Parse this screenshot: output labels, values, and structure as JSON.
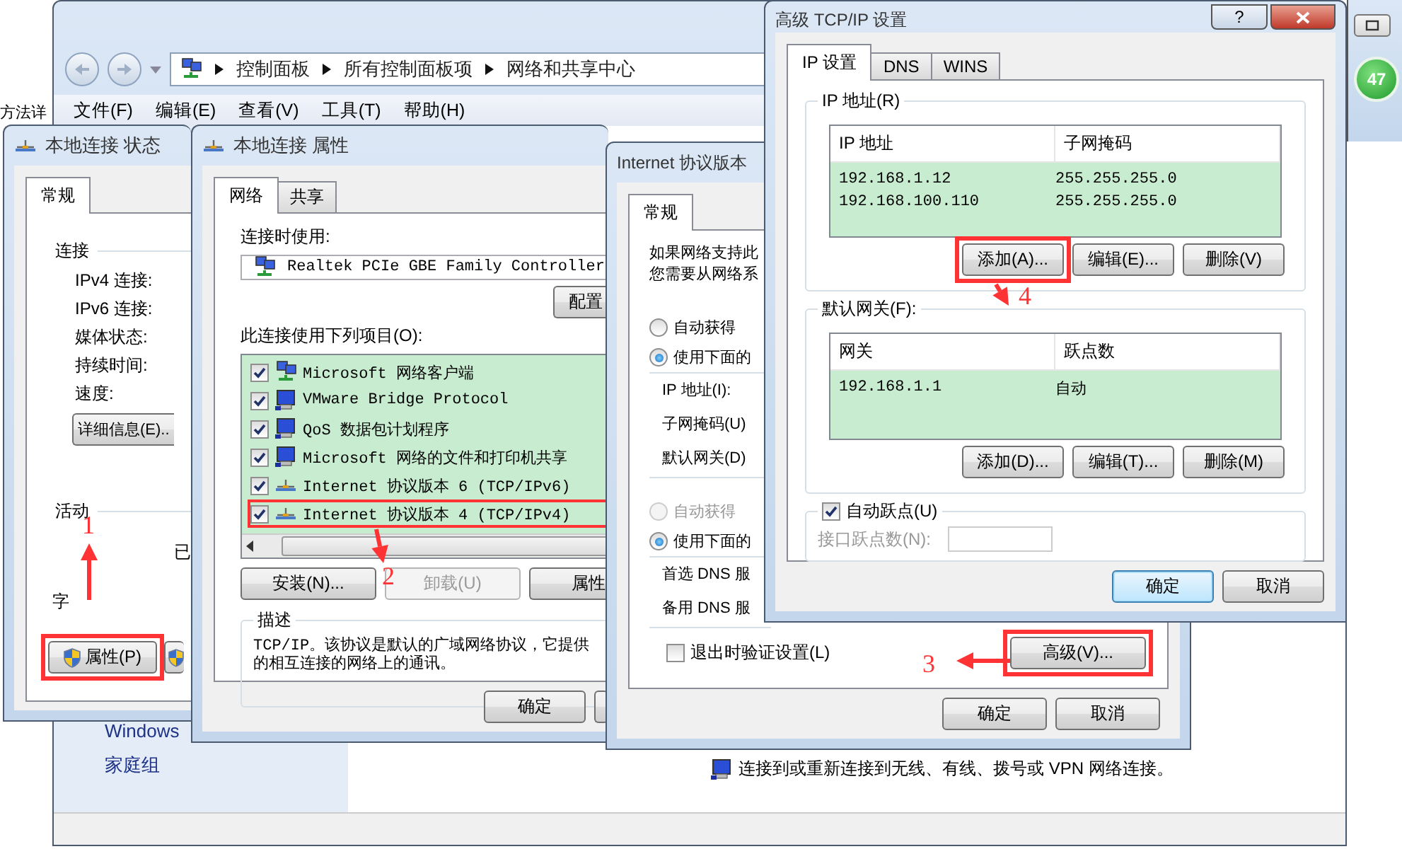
{
  "background_page": {
    "text": "方法详"
  },
  "explorer": {
    "breadcrumb": [
      "控制面板",
      "所有控制面板项",
      "网络和共享中心"
    ],
    "menu": [
      "文件(F)",
      "编辑(E)",
      "查看(V)",
      "工具(T)",
      "帮助(H)"
    ],
    "sidebar_links": [
      "Windows",
      "家庭组"
    ],
    "task_text": "连接到或重新连接到无线、有线、拨号或 VPN 网络连接。"
  },
  "side_window": {
    "badge": "47"
  },
  "status_dialog": {
    "title": "本地连接 状态",
    "tabs": [
      {
        "label": "常规",
        "selected": true
      }
    ],
    "connection_group": "连接",
    "fields": [
      "IPv4 连接:",
      "IPv6 连接:",
      "媒体状态:",
      "持续时间:",
      "速度:"
    ],
    "details_button": "详细信息(E)..",
    "activity_group": "活动",
    "activity_sent": "已",
    "activity_bytes": "字",
    "properties_button": {
      "label": "属性(P)",
      "highlighted": true
    }
  },
  "properties_dialog": {
    "title": "本地连接 属性",
    "tabs": [
      {
        "label": "网络",
        "selected": true
      },
      {
        "label": "共享",
        "selected": false
      }
    ],
    "connect_using_label": "连接时使用:",
    "adapter": "Realtek PCIe GBE Family Controller",
    "configure_button": "配置",
    "items_label": "此连接使用下列项目(O):",
    "items": [
      {
        "label": "Microsoft 网络客户端",
        "checked": true,
        "kind": "client",
        "highlighted": false
      },
      {
        "label": "VMware Bridge Protocol",
        "checked": true,
        "kind": "service",
        "highlighted": false
      },
      {
        "label": "QoS 数据包计划程序",
        "checked": true,
        "kind": "service",
        "highlighted": false
      },
      {
        "label": "Microsoft 网络的文件和打印机共享",
        "checked": true,
        "kind": "service",
        "highlighted": false
      },
      {
        "label": "Internet 协议版本 6 (TCP/IPv6)",
        "checked": true,
        "kind": "protocol",
        "highlighted": false
      },
      {
        "label": "Internet 协议版本 4 (TCP/IPv4)",
        "checked": true,
        "kind": "protocol",
        "highlighted": true
      }
    ],
    "buttons": [
      {
        "label": "安装(N)...",
        "disabled": false
      },
      {
        "label": "卸载(U)",
        "disabled": true
      },
      {
        "label": "属性",
        "disabled": false
      }
    ],
    "description_group": "描述",
    "description_lines": [
      "TCP/IP。该协议是默认的广域网络协议，它提供",
      "的相互连接的网络上的通讯。"
    ],
    "ok_button": "确定"
  },
  "ipv4_dialog": {
    "title": "Internet 协议版本",
    "tabs": [
      {
        "label": "常规",
        "selected": true
      }
    ],
    "intro_lines": [
      "如果网络支持此",
      "您需要从网络系"
    ],
    "ip_radios": [
      {
        "label": "自动获得",
        "selected": false,
        "disabled": false
      },
      {
        "label": "使用下面的",
        "selected": true,
        "disabled": false
      }
    ],
    "ip_fields": [
      "IP 地址(I):",
      "子网掩码(U)",
      "默认网关(D)"
    ],
    "dns_radios": [
      {
        "label": "自动获得",
        "selected": false,
        "disabled": true
      },
      {
        "label": "使用下面的",
        "selected": true,
        "disabled": false
      }
    ],
    "dns_fields": [
      "首选 DNS 服",
      "备用 DNS 服"
    ],
    "validate_checkbox": {
      "label": "退出时验证设置(L)",
      "checked": false
    },
    "advanced_button": {
      "label": "高级(V)...",
      "highlighted": true
    },
    "buttons": [
      "确定",
      "取消"
    ]
  },
  "advanced_dialog": {
    "title": "高级 TCP/IP 设置",
    "help_button": "?",
    "tabs": [
      {
        "label": "IP 设置",
        "selected": true
      },
      {
        "label": "DNS",
        "selected": false
      },
      {
        "label": "WINS",
        "selected": false
      }
    ],
    "ip_group": "IP 地址(R)",
    "ip_columns": [
      "IP 地址",
      "子网掩码"
    ],
    "ip_rows": [
      [
        "192.168.1.12",
        "255.255.255.0"
      ],
      [
        "192.168.100.110",
        "255.255.255.0"
      ]
    ],
    "ip_buttons": [
      {
        "label": "添加(A)...",
        "highlighted": true
      },
      {
        "label": "编辑(E)...",
        "highlighted": false
      },
      {
        "label": "删除(V)",
        "highlighted": false
      }
    ],
    "gateway_group": "默认网关(F):",
    "gateway_columns": [
      "网关",
      "跃点数"
    ],
    "gateway_rows": [
      [
        "192.168.1.1",
        "自动"
      ]
    ],
    "gateway_buttons": [
      "添加(D)...",
      "编辑(T)...",
      "删除(M)"
    ],
    "auto_metric": {
      "label": "自动跃点(U)",
      "checked": true
    },
    "interface_metric": {
      "label": "接口跃点数(N):",
      "disabled": true
    },
    "buttons": [
      {
        "label": "确定",
        "default": true
      },
      {
        "label": "取消",
        "default": false
      }
    ]
  },
  "annotations": [
    {
      "label": "1"
    },
    {
      "label": "2"
    },
    {
      "label": "3"
    },
    {
      "label": "4"
    }
  ]
}
